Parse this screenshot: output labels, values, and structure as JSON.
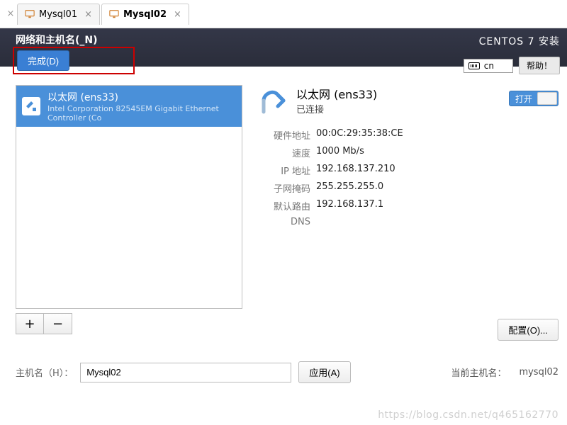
{
  "tabs": [
    {
      "label": "Mysql01",
      "active": false
    },
    {
      "label": "Mysql02",
      "active": true
    }
  ],
  "header": {
    "page_title": "网络和主机名(_N)",
    "done_label": "完成(D)",
    "installer_title": "CENTOS 7 安装",
    "keyboard_layout": "cn",
    "help_label": "帮助！"
  },
  "network_list": {
    "items": [
      {
        "title": "以太网 (ens33)",
        "subtitle": "Intel Corporation 82545EM Gigabit Ethernet Controller (Co"
      }
    ]
  },
  "detail": {
    "title": "以太网 (ens33)",
    "status": "已连接",
    "toggle_on_label": "打开",
    "props": {
      "hw_label": "硬件地址",
      "hw_value": "00:0C:29:35:38:CE",
      "speed_label": "速度",
      "speed_value": "1000 Mb/s",
      "ip_label": "IP 地址",
      "ip_value": "192.168.137.210",
      "mask_label": "子网掩码",
      "mask_value": "255.255.255.0",
      "gw_label": "默认路由",
      "gw_value": "192.168.137.1",
      "dns_label": "DNS",
      "dns_value": ""
    },
    "configure_label": "配置(O)..."
  },
  "hostname": {
    "label": "主机名（H）：",
    "value": "Mysql02",
    "apply_label": "应用(A)",
    "current_label": "当前主机名：",
    "current_value": "mysql02"
  },
  "watermark": "https://blog.csdn.net/q465162770"
}
